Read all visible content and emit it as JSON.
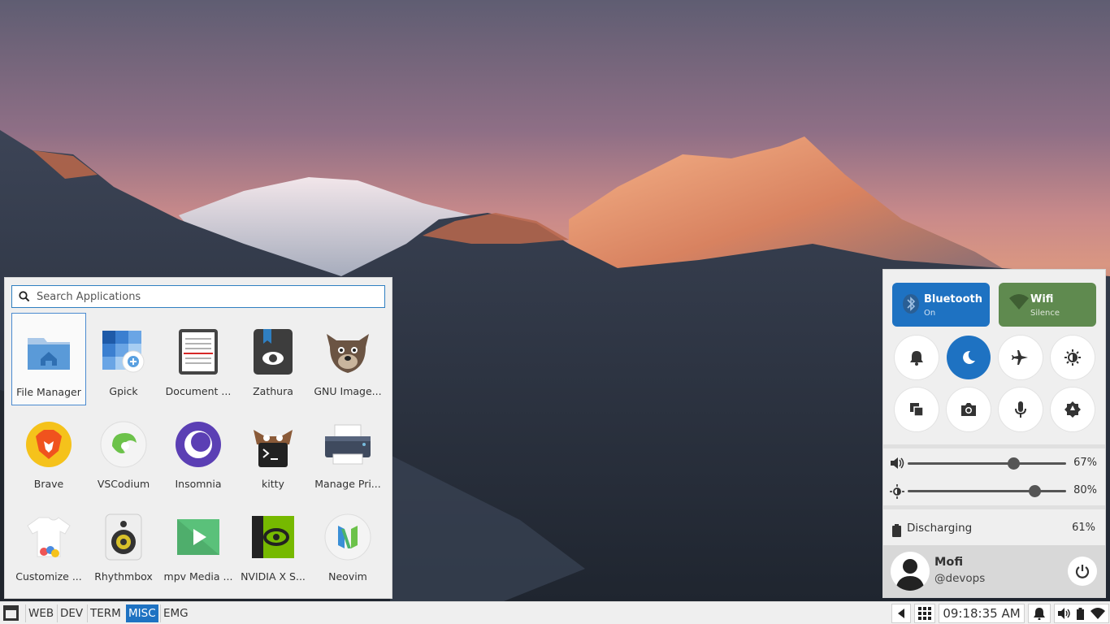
{
  "launcher": {
    "search_placeholder": "Search Applications",
    "apps": [
      {
        "label": "File Manager",
        "icon": "folder-home-icon"
      },
      {
        "label": "Gpick",
        "icon": "gpick-icon"
      },
      {
        "label": "Document ...",
        "icon": "document-viewer-icon"
      },
      {
        "label": "Zathura",
        "icon": "zathura-icon"
      },
      {
        "label": "GNU Image...",
        "icon": "gimp-icon"
      },
      {
        "label": "Brave",
        "icon": "brave-icon"
      },
      {
        "label": "VSCodium",
        "icon": "vscodium-icon"
      },
      {
        "label": "Insomnia",
        "icon": "insomnia-icon"
      },
      {
        "label": "kitty",
        "icon": "kitty-icon"
      },
      {
        "label": "Manage Pri...",
        "icon": "printer-icon"
      },
      {
        "label": "Customize ...",
        "icon": "customize-icon"
      },
      {
        "label": "Rhythmbox",
        "icon": "rhythmbox-icon"
      },
      {
        "label": "mpv Media ...",
        "icon": "mpv-icon"
      },
      {
        "label": "NVIDIA X S...",
        "icon": "nvidia-icon"
      },
      {
        "label": "Neovim",
        "icon": "neovim-icon"
      }
    ]
  },
  "control_center": {
    "bluetooth": {
      "title": "Bluetooth",
      "status": "On",
      "color": "#1e72c2"
    },
    "wifi": {
      "title": "Wifi",
      "status": "Silence",
      "color": "#5f8a4f"
    },
    "volume": {
      "value": 0.67,
      "label": "67%"
    },
    "brightness": {
      "value": 0.8,
      "label": "80%"
    },
    "battery": {
      "status": "Discharging",
      "percent": "61%"
    },
    "user": {
      "name": "Mofi",
      "handle": "@devops"
    }
  },
  "taskbar": {
    "workspaces": [
      "WEB",
      "DEV",
      "TERM",
      "MISC",
      "EMG"
    ],
    "active_workspace": "MISC",
    "clock": "09:18:35 AM"
  }
}
